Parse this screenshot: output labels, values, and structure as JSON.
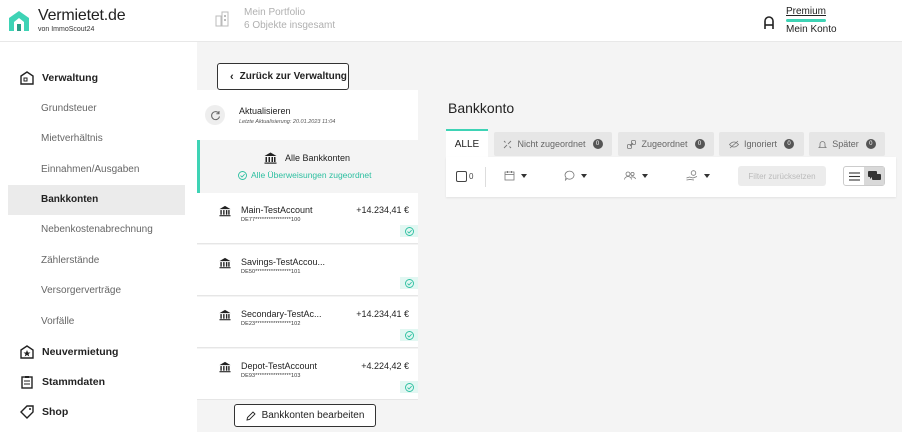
{
  "header": {
    "logo_title": "Vermietet.de",
    "logo_sub": "von ImmoScout24",
    "portfolio_title": "Mein Portfolio",
    "portfolio_sub": "6 Objekte insgesamt",
    "account_plan": "Premium",
    "account_label": "Mein Konto"
  },
  "sidebar": {
    "sections": [
      {
        "label": "Verwaltung",
        "icon": "house-icon"
      },
      {
        "label": "Neuvermietung",
        "icon": "house-star-icon"
      },
      {
        "label": "Stammdaten",
        "icon": "clipboard-icon"
      },
      {
        "label": "Shop",
        "icon": "tag-icon"
      }
    ],
    "items": [
      {
        "label": "Grundsteuer"
      },
      {
        "label": "Mietverhältnis"
      },
      {
        "label": "Einnahmen/Ausgaben"
      },
      {
        "label": "Bankkonten"
      },
      {
        "label": "Nebenkostenabrechnung"
      },
      {
        "label": "Zählerstände"
      },
      {
        "label": "Versorgerverträge"
      },
      {
        "label": "Vorfälle"
      }
    ]
  },
  "accounts_panel": {
    "back_label": "Zurück zur Verwaltung",
    "refresh_title": "Aktualisieren",
    "refresh_sub": "Letzte Aktualisierung: 20.01.2023 11:04",
    "all_title": "Alle Bankkonten",
    "all_sub": "Alle Überweisungen zugeordnet",
    "accounts": [
      {
        "name": "Main-TestAccount",
        "iban": "DE77****************100",
        "amount": "+14.234,41 €"
      },
      {
        "name": "Savings-TestAccou...",
        "iban": "DE50****************101",
        "amount": ""
      },
      {
        "name": "Secondary-TestAc...",
        "iban": "DE23****************102",
        "amount": "+14.234,41 €"
      },
      {
        "name": "Depot-TestAccount",
        "iban": "DE93****************103",
        "amount": "+4.224,42 €"
      }
    ],
    "edit_label": "Bankkonten bearbeiten"
  },
  "main": {
    "title": "Bankkonto",
    "tabs": [
      {
        "label": "ALLE",
        "count": ""
      },
      {
        "label": "Nicht zugeordnet",
        "count": "0"
      },
      {
        "label": "Zugeordnet",
        "count": "0"
      },
      {
        "label": "Ignoriert",
        "count": "0"
      },
      {
        "label": "Später",
        "count": "0"
      }
    ],
    "select_count": "0",
    "reset_label": "Filter zurücksetzen"
  },
  "colors": {
    "accent": "#3ed3b5",
    "accent_text": "#2cbfa0"
  }
}
